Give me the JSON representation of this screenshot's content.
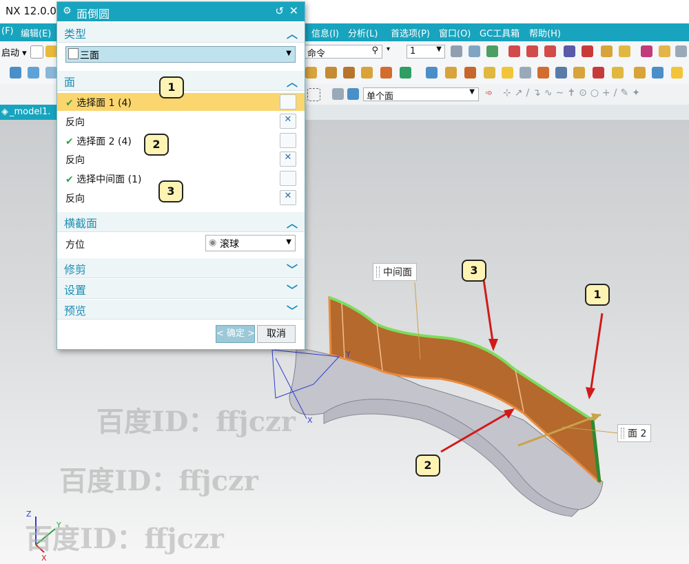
{
  "app": {
    "title": "NX 12.0.0"
  },
  "menu": [
    "(F)",
    "编辑(E)",
    "信息(I)",
    "分析(L)",
    "首选项(P)",
    "窗口(O)",
    "GC工具箱",
    "帮助(H)"
  ],
  "toolbar": {
    "start_label": "启动 ▾",
    "command_search_text": "命令",
    "layer_value": "1",
    "selection_filter": "单个面"
  },
  "doc_tab": "_model1.",
  "dialog": {
    "title": "面倒圆",
    "type_section": "类型",
    "type_value": "三面",
    "face_section": "面",
    "select_face1": "选择面 1 (4)",
    "reverse1": "反向",
    "select_face2": "选择面 2 (4)",
    "reverse2": "反向",
    "select_middle": "选择中间面 (1)",
    "reverse3": "反向",
    "cross_section": "横截面",
    "orientation_label": "方位",
    "orientation_value": "滚球",
    "trim_section": "修剪",
    "settings_section": "设置",
    "preview_section": "预览",
    "ok_button": "< 确定 >",
    "cancel_button": "取消"
  },
  "callouts": {
    "c1": "1",
    "c2": "2",
    "c3": "3"
  },
  "viewport": {
    "label_middle": "中间面",
    "label_face2": "面 2",
    "axis_x": "X",
    "axis_y": "Y",
    "axis_z": "Z"
  },
  "watermark": "百度ID：ffjczr",
  "colors": {
    "accent": "#18a4be",
    "highlight_row": "#fbd66e",
    "callout_fill": "#fdf4b4",
    "fillet_surface": "#b5692d",
    "arrow_red": "#d11a1a"
  }
}
